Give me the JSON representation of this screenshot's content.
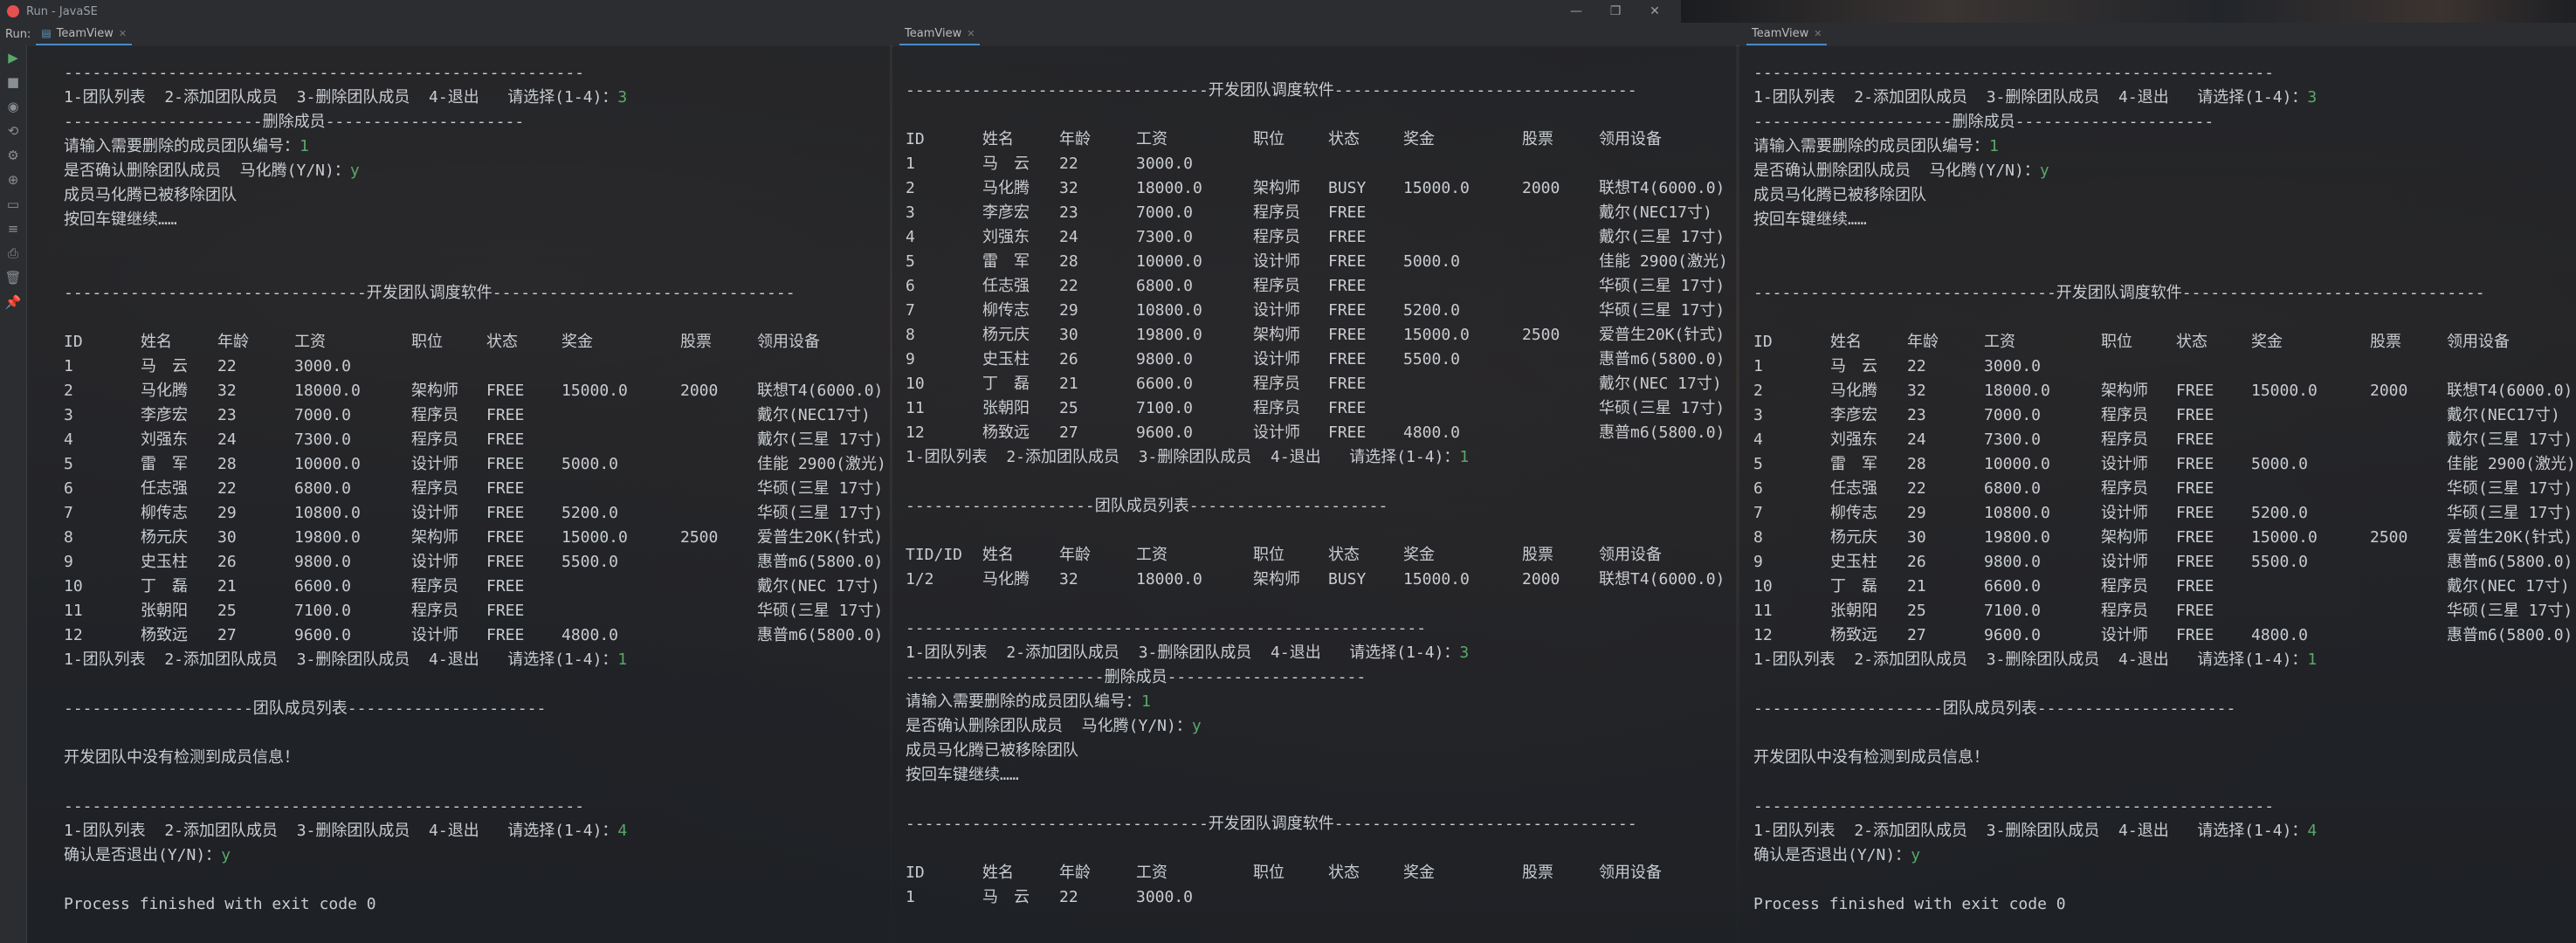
{
  "window": {
    "app_title": "Run - JavaSE"
  },
  "run_label": "Run:",
  "tab_name": "TeamView",
  "labels": {
    "main_title": "--------------------------------开发团队调度软件--------------------------------",
    "dash_line": "-------------------------------------------------------",
    "menu": "1-团队列表  2-添加团队成员  3-删除团队成员  4-退出   请选择(1-4)：",
    "delete_header": "---------------------删除成员---------------------",
    "team_list_header": "--------------------团队成员列表---------------------",
    "delete_prompt": "请输入需要删除的成员团队编号：",
    "confirm_delete": "是否确认删除团队成员  马化腾(Y/N)：",
    "removed": "成员马化腾已被移除团队",
    "press_enter": "按回车键继续……",
    "no_members": "开发团队中没有检测到成员信息！",
    "confirm_exit": "确认是否退出(Y/N)：",
    "process_finished": "Process finished with exit code 0"
  },
  "inputs": {
    "del": "3",
    "one": "1",
    "y": "y",
    "four": "4",
    "num1": "1"
  },
  "headers": [
    "ID",
    "姓名",
    "年龄",
    "工资",
    "职位",
    "状态",
    "奖金",
    "股票",
    "领用设备"
  ],
  "team_headers": [
    "TID/ID",
    "姓名",
    "年龄",
    "工资",
    "职位",
    "状态",
    "奖金",
    "股票",
    "领用设备"
  ],
  "team_row": [
    "1/2",
    "马化腾",
    "32",
    "18000.0",
    "架构师",
    "BUSY",
    "15000.0",
    "2000",
    "联想T4(6000.0)"
  ],
  "employees_free": [
    [
      "1",
      "马　云",
      "22",
      "3000.0",
      "",
      "",
      "",
      "",
      ""
    ],
    [
      "2",
      "马化腾",
      "32",
      "18000.0",
      "架构师",
      "FREE",
      "15000.0",
      "2000",
      "联想T4(6000.0)"
    ],
    [
      "3",
      "李彦宏",
      "23",
      "7000.0",
      "程序员",
      "FREE",
      "",
      "",
      "戴尔(NEC17寸)"
    ],
    [
      "4",
      "刘强东",
      "24",
      "7300.0",
      "程序员",
      "FREE",
      "",
      "",
      "戴尔(三星 17寸)"
    ],
    [
      "5",
      "雷　军",
      "28",
      "10000.0",
      "设计师",
      "FREE",
      "5000.0",
      "",
      "佳能 2900(激光)"
    ],
    [
      "6",
      "任志强",
      "22",
      "6800.0",
      "程序员",
      "FREE",
      "",
      "",
      "华硕(三星 17寸)"
    ],
    [
      "7",
      "柳传志",
      "29",
      "10800.0",
      "设计师",
      "FREE",
      "5200.0",
      "",
      "华硕(三星 17寸)"
    ],
    [
      "8",
      "杨元庆",
      "30",
      "19800.0",
      "架构师",
      "FREE",
      "15000.0",
      "2500",
      "爱普生20K(针式)"
    ],
    [
      "9",
      "史玉柱",
      "26",
      "9800.0",
      "设计师",
      "FREE",
      "5500.0",
      "",
      "惠普m6(5800.0)"
    ],
    [
      "10",
      "丁　磊",
      "21",
      "6600.0",
      "程序员",
      "FREE",
      "",
      "",
      "戴尔(NEC 17寸)"
    ],
    [
      "11",
      "张朝阳",
      "25",
      "7100.0",
      "程序员",
      "FREE",
      "",
      "",
      "华硕(三星 17寸)"
    ],
    [
      "12",
      "杨致远",
      "27",
      "9600.0",
      "设计师",
      "FREE",
      "4800.0",
      "",
      "惠普m6(5800.0)"
    ]
  ],
  "employees_busy": [
    [
      "1",
      "马　云",
      "22",
      "3000.0",
      "",
      "",
      "",
      "",
      ""
    ],
    [
      "2",
      "马化腾",
      "32",
      "18000.0",
      "架构师",
      "BUSY",
      "15000.0",
      "2000",
      "联想T4(6000.0)"
    ],
    [
      "3",
      "李彦宏",
      "23",
      "7000.0",
      "程序员",
      "FREE",
      "",
      "",
      "戴尔(NEC17寸)"
    ],
    [
      "4",
      "刘强东",
      "24",
      "7300.0",
      "程序员",
      "FREE",
      "",
      "",
      "戴尔(三星 17寸)"
    ],
    [
      "5",
      "雷　军",
      "28",
      "10000.0",
      "设计师",
      "FREE",
      "5000.0",
      "",
      "佳能 2900(激光)"
    ],
    [
      "6",
      "任志强",
      "22",
      "6800.0",
      "程序员",
      "FREE",
      "",
      "",
      "华硕(三星 17寸)"
    ],
    [
      "7",
      "柳传志",
      "29",
      "10800.0",
      "设计师",
      "FREE",
      "5200.0",
      "",
      "华硕(三星 17寸)"
    ],
    [
      "8",
      "杨元庆",
      "30",
      "19800.0",
      "架构师",
      "FREE",
      "15000.0",
      "2500",
      "爱普生20K(针式)"
    ],
    [
      "9",
      "史玉柱",
      "26",
      "9800.0",
      "设计师",
      "FREE",
      "5500.0",
      "",
      "惠普m6(5800.0)"
    ],
    [
      "10",
      "丁　磊",
      "21",
      "6600.0",
      "程序员",
      "FREE",
      "",
      "",
      "戴尔(NEC 17寸)"
    ],
    [
      "11",
      "张朝阳",
      "25",
      "7100.0",
      "程序员",
      "FREE",
      "",
      "",
      "华硕(三星 17寸)"
    ],
    [
      "12",
      "杨致远",
      "27",
      "9600.0",
      "设计师",
      "FREE",
      "4800.0",
      "",
      "惠普m6(5800.0)"
    ]
  ],
  "pane_bottom_row": [
    "1",
    "马　云",
    "22",
    "3000.0"
  ],
  "colors": {
    "input_green": "#59a869",
    "text": "#c8ccd0",
    "toolbar_bg": "#2b2d30"
  }
}
